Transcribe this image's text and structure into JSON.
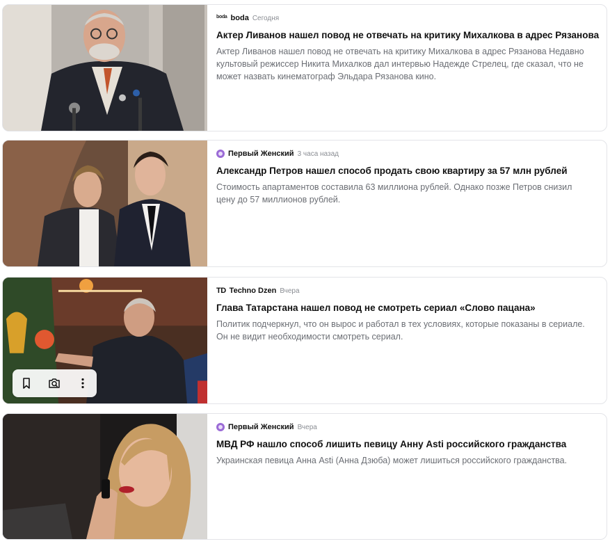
{
  "feed": {
    "items": [
      {
        "source": "boda",
        "source_logo": "boda-logo",
        "time": "Сегодня",
        "title": "Актер Ливанов нашел повод не отвечать на критику Михалкова в адрес Рязанова",
        "snippet": "Актер Ливанов нашел повод не отвечать на критику Михалкова в адрес Рязанова Недавно культовый режиссер Никита Михалков дал интервью Надежде Стрелец, где сказал, что не может назвать кинематограф Эльдара Рязанова кино."
      },
      {
        "source": "Первый Женский",
        "source_logo": "purple-circle-logo",
        "time": "3 часа назад",
        "title": "Александр Петров нашел способ продать свою квартиру за 57 млн рублей",
        "snippet": "Стоимость апартаментов составила 63 миллиона рублей. Однако позже Петров снизил цену до 57 миллионов рублей."
      },
      {
        "source": "Techno Dzen",
        "source_logo": "td-logo",
        "time": "Вчера",
        "title": "Глава Татарстана нашел повод не смотреть сериал «Слово пацана»",
        "snippet": "Политик подчеркнул, что он вырос и работал в тех условиях, которые показаны в сериале. Он не видит необходимости смотреть сериал."
      },
      {
        "source": "Первый Женский",
        "source_logo": "purple-circle-logo",
        "time": "Вчера",
        "title": "МВД РФ нашло способ лишить певицу Анну Asti российского гражданства",
        "snippet": "Украинская певица Анна Asti (Анна Дзюба) может лишиться российского гражданства."
      }
    ],
    "boda_logo_text": "boda",
    "td_logo_text": "TD"
  },
  "image_toolbar": {
    "icons": [
      "bookmark-icon",
      "camera-search-icon",
      "more-vertical-icon"
    ]
  },
  "colors": {
    "title": "#111111",
    "snippet": "#6b6e74",
    "time": "#8a8d93",
    "border": "#e3e4e8",
    "purple_logo": "#9b6bd6"
  }
}
